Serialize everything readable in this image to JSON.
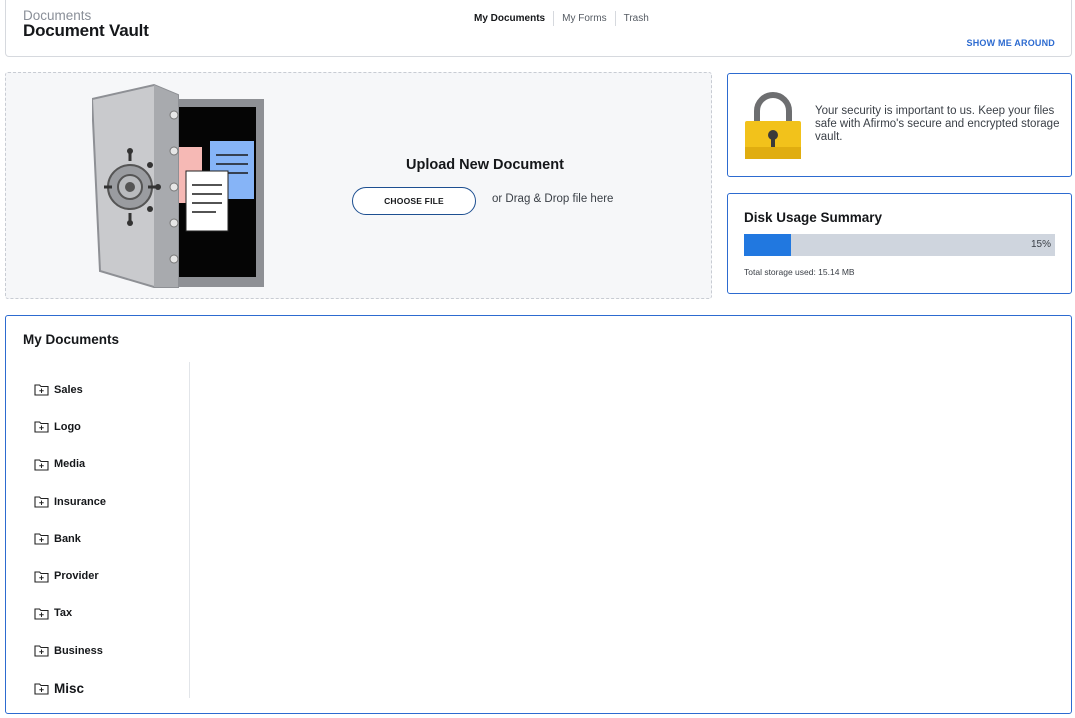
{
  "header": {
    "breadcrumb": "Documents",
    "title": "Document Vault",
    "tabs": [
      {
        "label": "My Documents",
        "active": true
      },
      {
        "label": "My Forms",
        "active": false
      },
      {
        "label": "Trash",
        "active": false
      }
    ],
    "show_me_around": "SHOW ME AROUND"
  },
  "upload": {
    "title": "Upload New Document",
    "choose_file": "CHOOSE FILE",
    "drag_drop": "or Drag & Drop file here"
  },
  "security": {
    "message": "Your security is important to us. Keep your files safe with Afirmo's secure and encrypted storage vault."
  },
  "disk": {
    "title": "Disk Usage Summary",
    "percent_label": "15%",
    "percent": 15,
    "used_label": "Total storage used: 15.14 MB"
  },
  "documents": {
    "title": "My Documents",
    "folders": [
      {
        "label": "Sales"
      },
      {
        "label": "Logo"
      },
      {
        "label": "Media"
      },
      {
        "label": "Insurance"
      },
      {
        "label": "Bank"
      },
      {
        "label": "Provider"
      },
      {
        "label": "Tax"
      },
      {
        "label": "Business"
      },
      {
        "label": "Misc"
      }
    ]
  },
  "colors": {
    "accent": "#2d6bd0",
    "progress": "#2178e0",
    "progress_track": "#cfd5de",
    "lock_body": "#f2c21b"
  }
}
